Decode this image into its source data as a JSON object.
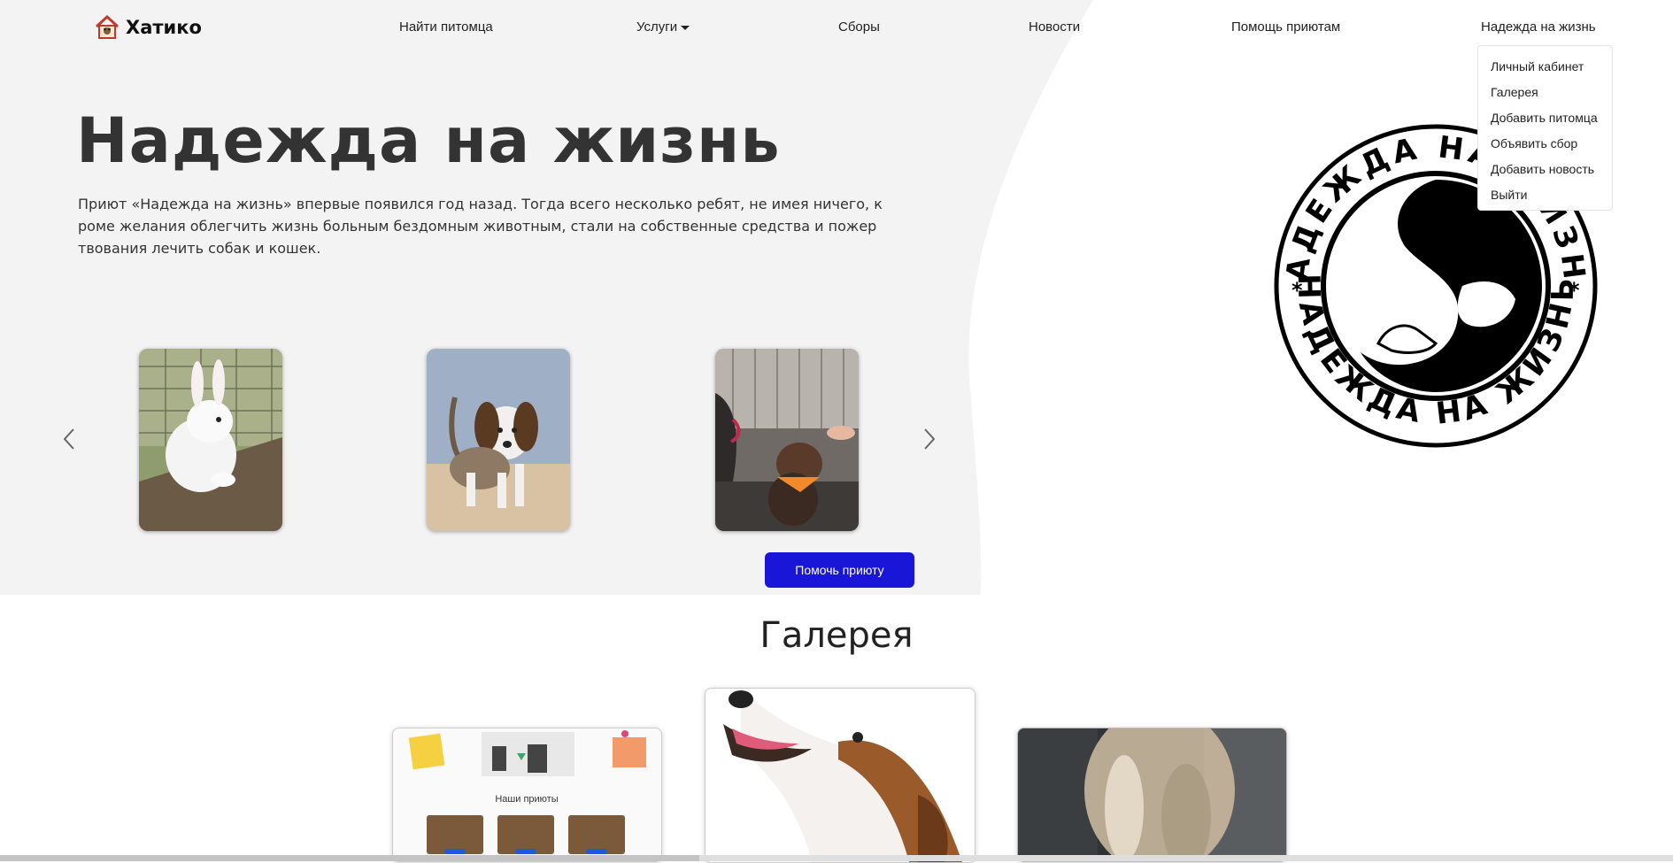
{
  "nav": {
    "logo_text": "Хатико",
    "links": [
      "Найти питомца",
      "Услуги",
      "Сборы",
      "Новости",
      "Помощь приютам",
      "Надежда на жизнь"
    ]
  },
  "dropdown": {
    "items": [
      "Личный кабинет",
      "Галерея",
      "Добавить питомца",
      "Объявить сбор",
      "Добавить новость",
      "Выйти"
    ]
  },
  "hero": {
    "title": "Надежда на жизнь",
    "description": "Приют «Надежда на жизнь» впервые появился год назад. Тогда всего несколько ребят, не имея ничего, кроме желания облегчить жизнь больным бездомным животным, стали на собственные средства и пожертвования лечить собак и кошек.",
    "help_button": "Помочь приюту"
  },
  "emblem": {
    "ring_text": "НАДЕЖДА НА ЖИЗНЬ"
  },
  "carousel": {
    "images": [
      "white-rabbit-photo",
      "beagle-puppy-photo",
      "brown-puppy-photo"
    ]
  },
  "gallery": {
    "title": "Галерея",
    "card1_caption": "Наши приюты"
  },
  "colors": {
    "accent": "#1a16d8",
    "hero_bg": "#f3f3f3"
  }
}
